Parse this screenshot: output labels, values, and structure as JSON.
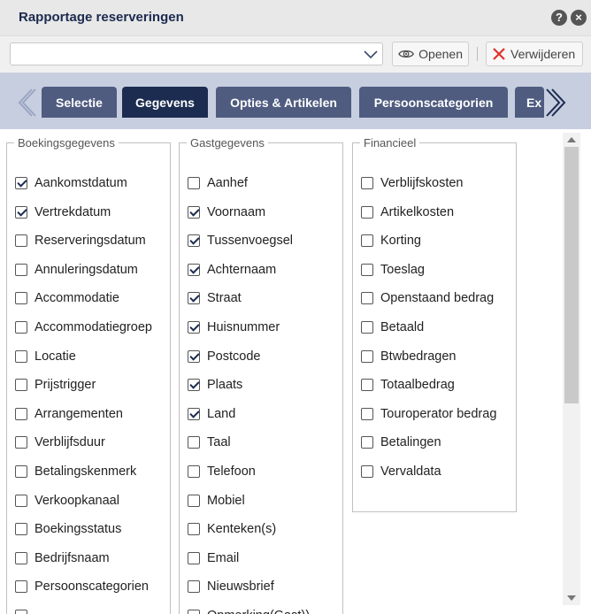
{
  "window": {
    "title": "Rapportage reserveringen",
    "help_icon": "?",
    "close_icon": "×"
  },
  "toolbar": {
    "select_value": "",
    "open_label": "Openen",
    "delete_label": "Verwijderen"
  },
  "tabs": [
    {
      "label": "Selectie",
      "active": false
    },
    {
      "label": "Gegevens",
      "active": true
    },
    {
      "label": "Opties & Artikelen",
      "active": false
    },
    {
      "label": "Persoonscategorien",
      "active": false
    },
    {
      "label": "Ex",
      "active": false
    }
  ],
  "groups": [
    {
      "legend": "Boekingsgegevens",
      "items": [
        {
          "label": "Aankomstdatum",
          "checked": true
        },
        {
          "label": "Vertrekdatum",
          "checked": true
        },
        {
          "label": "Reserveringsdatum",
          "checked": false
        },
        {
          "label": "Annuleringsdatum",
          "checked": false
        },
        {
          "label": "Accommodatie",
          "checked": false
        },
        {
          "label": "Accommodatiegroep",
          "checked": false
        },
        {
          "label": "Locatie",
          "checked": false
        },
        {
          "label": "Prijstrigger",
          "checked": false
        },
        {
          "label": "Arrangementen",
          "checked": false
        },
        {
          "label": "Verblijfsduur",
          "checked": false
        },
        {
          "label": "Betalingskenmerk",
          "checked": false
        },
        {
          "label": "Verkoopkanaal",
          "checked": false
        },
        {
          "label": "Boekingsstatus",
          "checked": false
        },
        {
          "label": "Bedrijfsnaam",
          "checked": false
        },
        {
          "label": "Persoonscategorien",
          "checked": false
        },
        {
          "label": "",
          "checked": false
        }
      ]
    },
    {
      "legend": "Gastgegevens",
      "items": [
        {
          "label": "Aanhef",
          "checked": false
        },
        {
          "label": "Voornaam",
          "checked": true
        },
        {
          "label": "Tussenvoegsel",
          "checked": true
        },
        {
          "label": "Achternaam",
          "checked": true
        },
        {
          "label": "Straat",
          "checked": true
        },
        {
          "label": "Huisnummer",
          "checked": true
        },
        {
          "label": "Postcode",
          "checked": true
        },
        {
          "label": "Plaats",
          "checked": true
        },
        {
          "label": "Land",
          "checked": true
        },
        {
          "label": "Taal",
          "checked": false
        },
        {
          "label": "Telefoon",
          "checked": false
        },
        {
          "label": "Mobiel",
          "checked": false
        },
        {
          "label": "Kenteken(s)",
          "checked": false
        },
        {
          "label": "Email",
          "checked": false
        },
        {
          "label": "Nieuwsbrief",
          "checked": false
        },
        {
          "label": "Opmerking(Gast))",
          "checked": false
        }
      ]
    },
    {
      "legend": "Financieel",
      "items": [
        {
          "label": "Verblijfskosten",
          "checked": false
        },
        {
          "label": "Artikelkosten",
          "checked": false
        },
        {
          "label": "Korting",
          "checked": false
        },
        {
          "label": "Toeslag",
          "checked": false
        },
        {
          "label": "Openstaand bedrag",
          "checked": false
        },
        {
          "label": "Betaald",
          "checked": false
        },
        {
          "label": "Btwbedragen",
          "checked": false
        },
        {
          "label": "Totaalbedrag",
          "checked": false
        },
        {
          "label": "Touroperator bedrag",
          "checked": false
        },
        {
          "label": "Betalingen",
          "checked": false
        },
        {
          "label": "Vervaldata",
          "checked": false
        }
      ]
    }
  ],
  "colors": {
    "tab_bg": "#4f5c80",
    "tab_active_bg": "#1c2c50",
    "tabstrip_bg": "#c7cedf",
    "delete_icon": "#e0312b"
  },
  "icons": {
    "help": "help-icon",
    "close": "close-icon",
    "open": "eye-icon",
    "delete": "x-icon",
    "prev": "chevron-left-icon",
    "next": "chevron-right-icon",
    "dropdown": "chevron-down-icon"
  }
}
